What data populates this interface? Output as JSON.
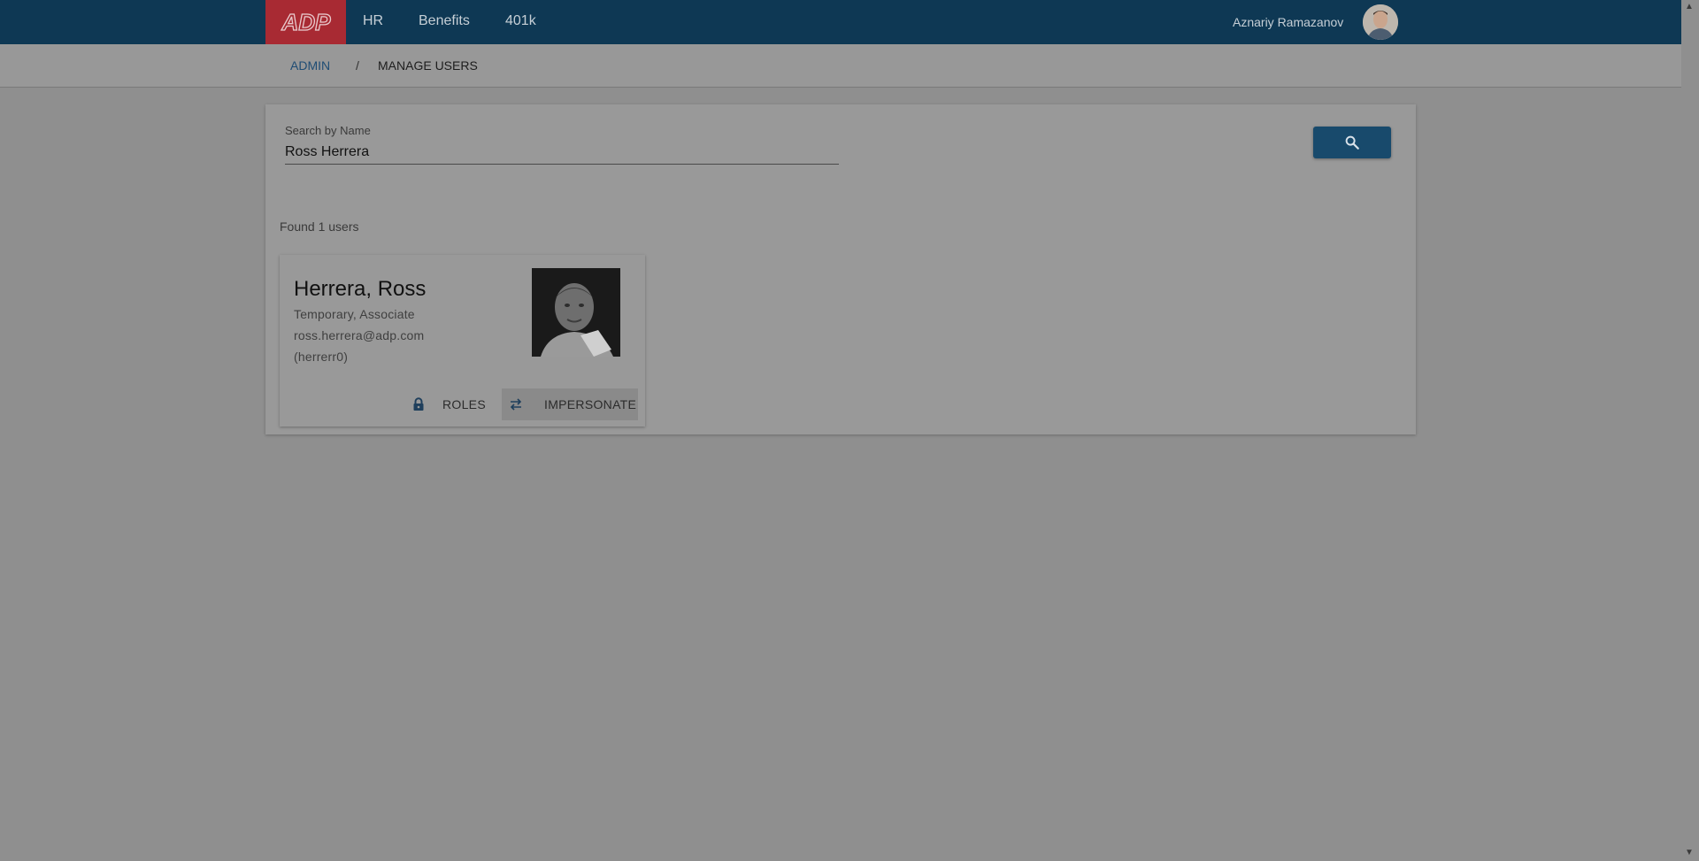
{
  "app": {
    "logo_text": "ADP",
    "brand_color": "#a82a33",
    "header_color": "#0e3854"
  },
  "nav": {
    "items": [
      {
        "label": "HR"
      },
      {
        "label": "Benefits"
      },
      {
        "label": "401k"
      }
    ],
    "user_name": "Aznariy Ramazanov",
    "avatar_icon": "user-avatar"
  },
  "breadcrumb": {
    "parent": "ADMIN",
    "separator": "/",
    "current": "MANAGE USERS"
  },
  "search": {
    "label": "Search by Name",
    "value": "Ross Herrera",
    "button_icon": "search-icon"
  },
  "results": {
    "summary": "Found 1 users",
    "users": [
      {
        "name": "Herrera, Ross",
        "position": "Temporary, Associate",
        "email": "ross.herrera@adp.com",
        "user_id": "(herrerr0)",
        "roles_label": "ROLES",
        "roles_icon": "lock-icon",
        "impersonate_label": "IMPERSONATE",
        "impersonate_icon": "swap-arrows-icon"
      }
    ]
  }
}
